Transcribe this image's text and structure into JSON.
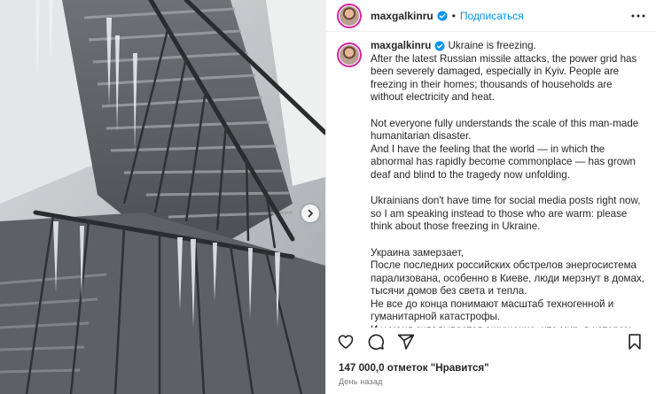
{
  "post": {
    "username": "maxgalkinru",
    "follow_label": "Подписаться",
    "separator": "•",
    "caption": "Ukraine is freezing.\nAfter the latest Russian missile attacks, the power grid has been severely damaged, especially in Kyiv. People are freezing in their homes; thousands of households are without electricity and heat.\n\nNot everyone fully understands the scale of this man-made humanitarian disaster.\nAnd I have the feeling that the world — in which the abnormal has rapidly become commonplace — has grown deaf and blind to the tragedy now unfolding.\n\nUkrainians don't have time for social media posts right now, so I am speaking instead to those who are warm: please think about those freezing in Ukraine.\n\nУкраина замерзает,\nПосле последних российских обстрелов энергосистема парализована, особенно в Киеве, люди мерзнут в домах, тысячи домов без света и тепла.\nНе все до конца понимают масштаб техногенной и гуманитарной катастрофы.\nИ у меня складывается ощущение, что мир, в котором стремительно ненормальное стало обыденным, глух и слеп к",
    "likes": "147 000,0 отметок \"Нравится\"",
    "time": "День назад"
  },
  "icons": {
    "verified": "verified-badge-icon",
    "more": "more-horizontal-icon",
    "like": "heart-icon",
    "comment": "comment-icon",
    "share": "share-icon",
    "save": "bookmark-icon",
    "next": "chevron-right-icon"
  },
  "colors": {
    "link": "#0095f6",
    "verified": "#0095f6",
    "text": "#262626",
    "muted": "#737373"
  }
}
